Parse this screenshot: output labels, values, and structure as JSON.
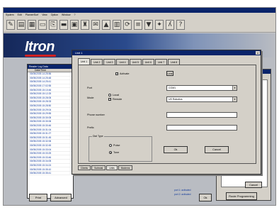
{
  "menu": [
    "System",
    "Edit",
    "PlannerSurf",
    "View",
    "Option",
    "Window",
    "?"
  ],
  "toolbar_icons": [
    "pen-icon",
    "chart-icon",
    "grid-icon",
    "tag-icon",
    "folder-icon",
    "card-icon",
    "save-icon",
    "binoculars-icon",
    "mail-icon",
    "flame-icon",
    "book-icon",
    "refresh-icon",
    "filter-icon",
    "signal-icon",
    "gear-icon",
    "y-icon",
    "help-icon"
  ],
  "toolbar_glyphs": [
    "✎",
    "▤",
    "▦",
    "▭",
    "⎘",
    "▬",
    "▣",
    "♜",
    "✉",
    "▲",
    "▥",
    "⟳",
    "≡",
    "▼",
    "✦",
    "ʎ",
    "?"
  ],
  "logo": "Itron",
  "left_panel": {
    "title": "Reader Log Data",
    "column": "Date/Time",
    "rows": [
      "05/05/2005 14:25:56",
      "05/05/2005 14:25:48",
      "05/05/2005 14:25:41",
      "05/05/2005 17:02:55",
      "05/05/2005 15:10:46",
      "05/05/2005 15:12:25",
      "05/05/2005 15:28:05",
      "05/05/2005 15:28:33",
      "05/05/2005 15:28:50",
      "05/05/2005 15:29:04",
      "05/05/2005 15:29:55",
      "05/05/2005 15:30:05",
      "05/05/2005 15:30:06",
      "05/05/2005 15:30:46",
      "05/05/2005 15:31:04",
      "05/05/2005 15:31:27",
      "05/05/2005 15:31:45",
      "05/05/2005 15:32:06",
      "05/05/2005 15:32:45",
      "05/05/2005 15:33:04",
      "05/05/2005 15:33:25",
      "05/05/2005 15:33:46",
      "05/05/2005 15:34:05",
      "05/05/2005 15:34:24",
      "05/05/2005 15:35:10",
      "05/05/2005 15:35:41"
    ]
  },
  "bottom_buttons": {
    "print": "Print",
    "advanced": "Advanced",
    "ok": "Ok",
    "route_programming": "Route Programming"
  },
  "dialog": {
    "title": "Unit 1",
    "close": "x",
    "tabs": [
      "Unit 1",
      "Unit 2",
      "Unit 3",
      "Unit 4",
      "Unit 5",
      "Unit 6",
      "Unit 7",
      "Unit 8"
    ],
    "activate": "Activate",
    "small_button": "Link",
    "port_label": "Port",
    "port_value": "COM1",
    "mode_label": "Mode",
    "local_label": "Local",
    "remote_label": "Remote",
    "mode_value": "US Robotics",
    "phone_label": "Phone number",
    "prefix_label": "Prefix",
    "dial_type_label": "Dial Type",
    "pulse_label": "Pulse",
    "tone_label": "Tone",
    "ok": "Ok",
    "cancel": "Cancel",
    "bottom_tabs": [
      "Clients",
      "Subtotal",
      "Units",
      "Modems"
    ]
  },
  "right_window": {
    "cancel": "Cancel",
    "note1": "port 1: activated",
    "note2": "port 2: activated"
  }
}
